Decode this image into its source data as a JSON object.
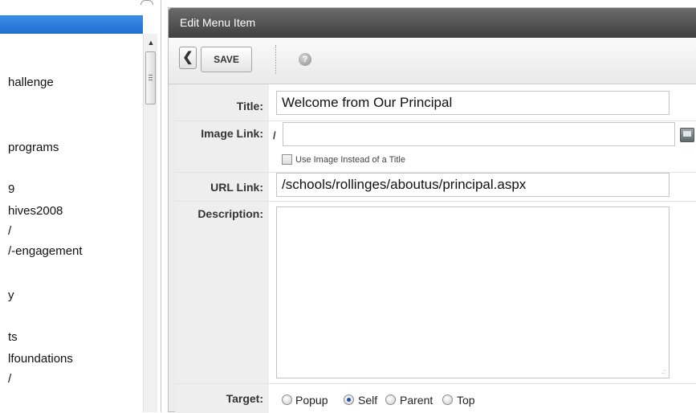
{
  "tree": {
    "items": [
      "hallenge",
      "programs",
      "9",
      "hives2008",
      "/",
      "/-engagement",
      "y",
      "ts",
      "lfoundations",
      "/"
    ]
  },
  "editor": {
    "title": "Edit Menu Item",
    "toolbar": {
      "back_icon": "chevron-left-icon",
      "save_label": "SAVE",
      "help_icon": "help-icon"
    },
    "fields": {
      "title_label": "Title:",
      "title_value": "Welcome from Our Principal",
      "image_link_label": "Image Link:",
      "image_link_prefix": "/",
      "image_link_value": "",
      "use_image_label": "Use Image Instead of a Title",
      "url_link_label": "URL Link:",
      "url_link_value": "/schools/rollinges/aboutus/principal.aspx",
      "description_label": "Description:",
      "description_value": "",
      "target_label": "Target:",
      "target_options": [
        "Popup",
        "Self",
        "Parent",
        "Top"
      ],
      "target_selected": "Self"
    }
  },
  "colors": {
    "header_blue": "#1f6fd0",
    "titlebar": "#4a4a4a",
    "radio_selected": "#1f4fa8"
  }
}
